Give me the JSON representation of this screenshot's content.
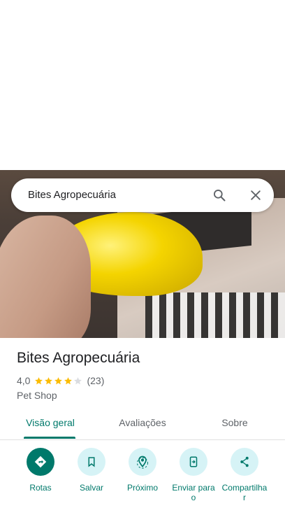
{
  "search": {
    "value": "Bites Agropecuária"
  },
  "place": {
    "name": "Bites Agropecuária",
    "rating": "4,0",
    "stars_filled": 4,
    "stars_total": 5,
    "reviews": "(23)",
    "category": "Pet Shop"
  },
  "tabs": [
    {
      "label": "Visão geral",
      "active": true
    },
    {
      "label": "Avaliações",
      "active": false
    },
    {
      "label": "Sobre",
      "active": false
    }
  ],
  "actions": [
    {
      "label": "Rotas",
      "icon": "directions-icon"
    },
    {
      "label": "Salvar",
      "icon": "bookmark-icon"
    },
    {
      "label": "Próximo",
      "icon": "nearby-icon"
    },
    {
      "label": "Enviar para o",
      "icon": "send-to-phone-icon"
    },
    {
      "label": "Compartilha r",
      "icon": "share-icon"
    }
  ],
  "colors": {
    "accent": "#00796b",
    "star": "#fbbc04",
    "chip_bg": "#d6f3f6"
  }
}
